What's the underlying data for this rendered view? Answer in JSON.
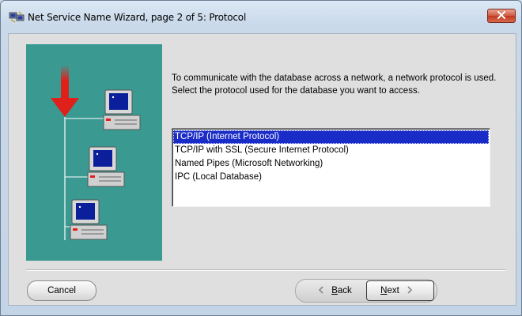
{
  "window": {
    "title": "Net Service Name Wizard, page 2 of 5: Protocol"
  },
  "main": {
    "description": "To communicate with the database across a network, a network protocol is used.  Select the protocol used for the database you want to access.",
    "protocols": [
      {
        "label": "TCP/IP (Internet Protocol)",
        "selected": true
      },
      {
        "label": "TCP/IP with SSL (Secure Internet Protocol)",
        "selected": false
      },
      {
        "label": "Named Pipes (Microsoft Networking)",
        "selected": false
      },
      {
        "label": "IPC (Local Database)",
        "selected": false
      }
    ]
  },
  "buttons": {
    "cancel_label": "Cancel",
    "back_label": "Back",
    "back_mnemonic": "B",
    "back_rest": "ack",
    "next_label": "Next",
    "next_mnemonic": "N",
    "next_rest": "ext"
  },
  "icons": {
    "app": "wizard-network-icon",
    "close": "close-icon",
    "back": "chevron-left-icon",
    "next": "chevron-right-icon"
  },
  "colors": {
    "illustration_bg": "#3a9a92",
    "selection": "#1a2cc7",
    "close_button": "#c0391f",
    "arrow": "#e0201a"
  }
}
